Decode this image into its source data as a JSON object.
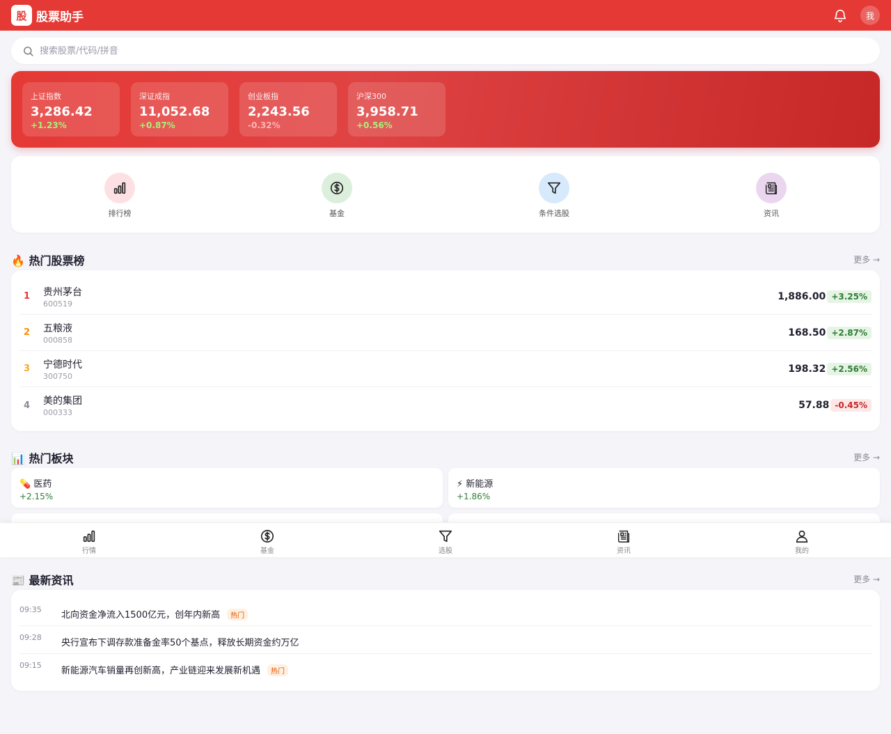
{
  "header": {
    "logo": "股",
    "title": "股票助手",
    "avatar": "我"
  },
  "search": {
    "placeholder": "搜索股票/代码/拼音"
  },
  "indices": [
    {
      "name": "上证指数",
      "value": "3,286.42",
      "change": "+1.23%",
      "dir": "up"
    },
    {
      "name": "深证成指",
      "value": "11,052.68",
      "change": "+0.87%",
      "dir": "up"
    },
    {
      "name": "创业板指",
      "value": "2,243.56",
      "change": "-0.32%",
      "dir": "down"
    },
    {
      "name": "沪深300",
      "value": "3,958.71",
      "change": "+0.56%",
      "dir": "up"
    }
  ],
  "quick_actions": [
    {
      "label": "排行榜",
      "icon": "bar-chart-icon",
      "bg": "#fde0e4"
    },
    {
      "label": "基金",
      "icon": "dollar-circle-icon",
      "bg": "#dcefdc"
    },
    {
      "label": "条件选股",
      "icon": "filter-icon",
      "bg": "#d6eafb"
    },
    {
      "label": "资讯",
      "icon": "newspaper-icon",
      "bg": "#ead7ef"
    }
  ],
  "hot_stocks": {
    "title": "🔥 热门股票榜",
    "more": "更多 →",
    "rows": [
      {
        "rank": "1",
        "name": "贵州茅台",
        "code": "600519",
        "price": "1,886.00",
        "change": "+3.25%",
        "dir": "up",
        "rank_color": "#e53935"
      },
      {
        "rank": "2",
        "name": "五粮液",
        "code": "000858",
        "price": "168.50",
        "change": "+2.87%",
        "dir": "up",
        "rank_color": "#fb8c00"
      },
      {
        "rank": "3",
        "name": "宁德时代",
        "code": "300750",
        "price": "198.32",
        "change": "+2.56%",
        "dir": "up",
        "rank_color": "#f9a825"
      },
      {
        "rank": "4",
        "name": "美的集团",
        "code": "000333",
        "price": "57.88",
        "change": "-0.45%",
        "dir": "down",
        "rank_color": "#8a8a98"
      }
    ]
  },
  "sectors": {
    "title": "📊 热门板块",
    "more": "更多 →",
    "items": [
      {
        "name": "💊 医药",
        "change": "+2.15%"
      },
      {
        "name": "⚡ 新能源",
        "change": "+1.86%"
      }
    ]
  },
  "bottom_nav": [
    {
      "label": "行情",
      "icon": "bar-chart-icon"
    },
    {
      "label": "基金",
      "icon": "dollar-circle-icon"
    },
    {
      "label": "选股",
      "icon": "filter-icon"
    },
    {
      "label": "资讯",
      "icon": "newspaper-icon"
    },
    {
      "label": "我的",
      "icon": "user-icon"
    }
  ],
  "news": {
    "title": "📰 最新资讯",
    "more": "更多 →",
    "items": [
      {
        "time": "09:35",
        "text": "北向资金净流入1500亿元，创年内新高",
        "tag": "热门"
      },
      {
        "time": "09:28",
        "text": "央行宣布下调存款准备金率50个基点，释放长期资金约万亿",
        "tag": ""
      },
      {
        "time": "09:15",
        "text": "新能源汽车销量再创新高，产业链迎来发展新机遇",
        "tag": "热门"
      }
    ]
  },
  "colors": {
    "brand": "#e53935",
    "up": "#2e7d32",
    "down": "#c62828"
  }
}
